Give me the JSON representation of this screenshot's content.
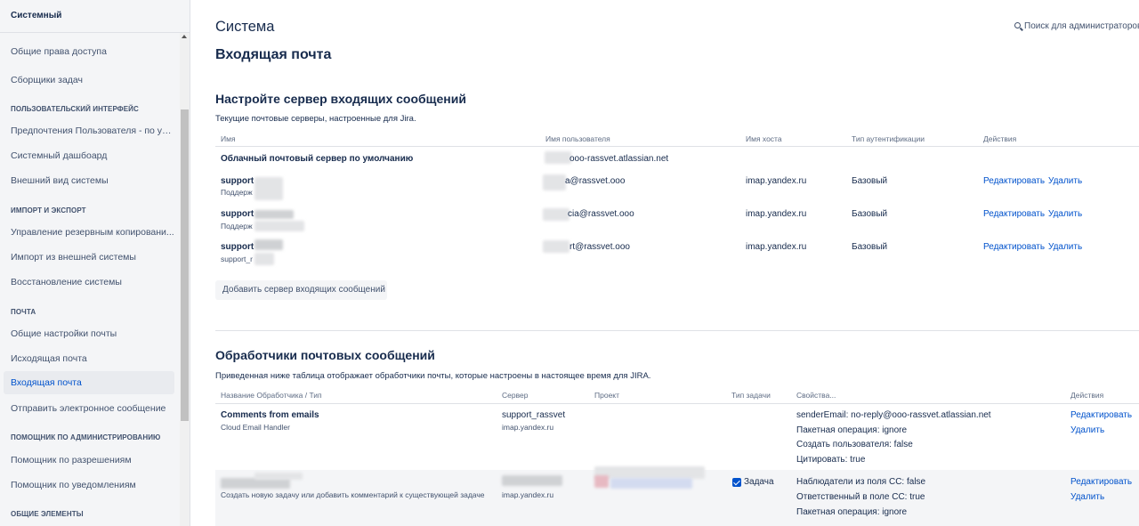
{
  "sidebar": {
    "top_label": "Системный",
    "items": [
      {
        "label": "Общие права доступа"
      },
      {
        "label": "Сборщики задач"
      },
      {
        "heading": "ПОЛЬЗОВАТЕЛЬСКИЙ ИНТЕРФЕЙС"
      },
      {
        "label": "Предпочтения Пользователя - по ум..."
      },
      {
        "label": "Системный дашбоард"
      },
      {
        "label": "Внешний вид системы"
      },
      {
        "heading": "ИМПОРТ И ЭКСПОРТ"
      },
      {
        "label": "Управление резервным копировани..."
      },
      {
        "label": "Импорт из внешней системы"
      },
      {
        "label": "Восстановление системы"
      },
      {
        "heading": "ПОЧТА"
      },
      {
        "label": "Общие настройки почты"
      },
      {
        "label": "Исходящая почта"
      },
      {
        "label": "Входящая почта",
        "active": true
      },
      {
        "label": "Отправить электронное сообщение"
      },
      {
        "heading": "ПОМОЩНИК ПО АДМИНИСТРИРОВАНИЮ"
      },
      {
        "label": "Помощник по разрешениям"
      },
      {
        "label": "Помощник по уведомлениям"
      },
      {
        "heading": "ОБЩИЕ ЭЛЕМЕНТЫ"
      }
    ]
  },
  "header": {
    "title": "Система",
    "page_title": "Входящая почта",
    "search_label": "Поиск для администраторов"
  },
  "servers": {
    "title": "Настройте сервер входящих сообщений",
    "description": "Текущие почтовые серверы, настроенные для Jira.",
    "columns": [
      "Имя",
      "Имя пользователя",
      "Имя хоста",
      "Тип аутентификации",
      "Действия"
    ],
    "rows": [
      {
        "name": "Облачный почтовый сервер по умолчанию",
        "sub": "",
        "user": "ooo-rassvet.atlassian.net",
        "host": "",
        "auth": "",
        "edit": "",
        "delete": ""
      },
      {
        "name": "support",
        "sub": "Поддерж",
        "user": "a@rassvet.ooo",
        "host": "imap.yandex.ru",
        "auth": "Базовый",
        "edit": "Редактировать",
        "delete": "Удалить"
      },
      {
        "name": "support",
        "sub": "Поддерж",
        "user": "cia@rassvet.ooo",
        "host": "imap.yandex.ru",
        "auth": "Базовый",
        "edit": "Редактировать",
        "delete": "Удалить"
      },
      {
        "name": "support",
        "sub": "support_r",
        "user": "rt@rassvet.ooo",
        "host": "imap.yandex.ru",
        "auth": "Базовый",
        "edit": "Редактировать",
        "delete": "Удалить"
      }
    ],
    "add_button": "Добавить сервер входящих сообщений"
  },
  "handlers": {
    "title": "Обработчики почтовых сообщений",
    "description": "Приведенная ниже таблица отображает обработчики почты, которые настроены в настоящее время для JIRA.",
    "columns": [
      "Название Обработчика / Тип",
      "Сервер",
      "Проект",
      "Тип задачи",
      "Свойства...",
      "Действия"
    ],
    "rows": [
      {
        "name": "Comments from emails",
        "type": "Cloud Email Handler",
        "server": "support_rassvet",
        "server_host": "imap.yandex.ru",
        "issue_type": "",
        "props": [
          "senderEmail: no-reply@ooo-rassvet.atlassian.net",
          "Пакетная операция: ignore",
          "Создать пользователя: false",
          "Цитировать: true"
        ],
        "edit": "Редактировать",
        "delete": "Удалить"
      },
      {
        "name": "",
        "type": "Создать новую задачу или добавить комментарий к существующей задаче",
        "server": "",
        "server_host": "imap.yandex.ru",
        "issue_type": "Задача",
        "props": [
          "Наблюдатели из поля CC: false",
          "Ответственный в поле CC: true",
          "Пакетная операция: ignore"
        ],
        "edit": "Редактировать",
        "delete": "Удалить"
      }
    ]
  },
  "colors": {
    "link": "#0052cc",
    "text": "#172b4d",
    "muted": "#5e6c84",
    "sidebar_bg": "#f4f5f7"
  }
}
